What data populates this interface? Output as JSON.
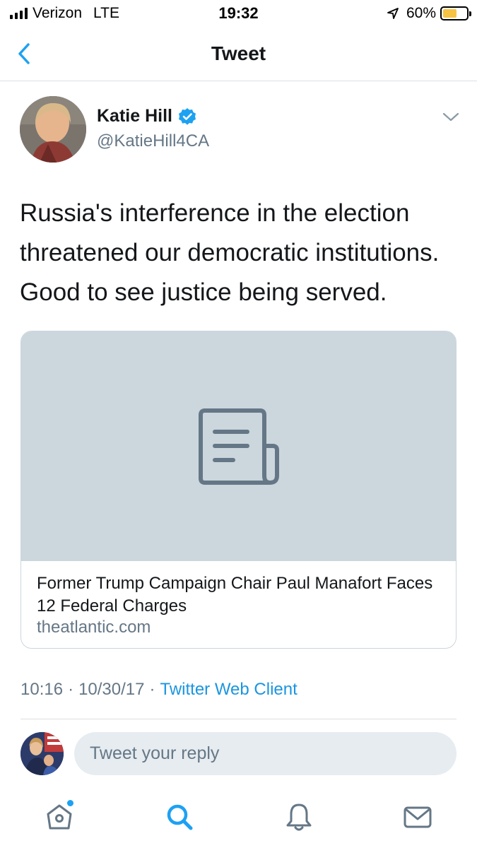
{
  "status_bar": {
    "carrier": "Verizon",
    "network": "LTE",
    "time": "19:32",
    "battery_percent": "60%",
    "battery_level": 0.6,
    "battery_color": "#f6c343"
  },
  "nav": {
    "title": "Tweet",
    "back_icon": "chevron-left-icon"
  },
  "tweet": {
    "author_name": "Katie Hill",
    "handle": "@KatieHill4CA",
    "verified": true,
    "text": "Russia's interference in the election threatened our democratic institutions. Good to see justice being served.",
    "card": {
      "icon": "document-icon",
      "title": "Former Trump Campaign Chair Paul Manafort Faces 12 Federal Charges",
      "domain": "theatlantic.com"
    },
    "time": "10:16",
    "date": "10/30/17",
    "separator": "·",
    "client": "Twitter Web Client"
  },
  "reply": {
    "placeholder": "Tweet your reply"
  },
  "tab_bar": {
    "items": [
      {
        "icon": "home-icon",
        "has_notification_dot": true
      },
      {
        "icon": "search-icon"
      },
      {
        "icon": "bell-icon"
      },
      {
        "icon": "mail-icon"
      }
    ]
  },
  "colors": {
    "accent": "#1da1f2",
    "link": "#1b95e0",
    "secondary_text": "#657786",
    "card_media": "#ccd6dd"
  }
}
